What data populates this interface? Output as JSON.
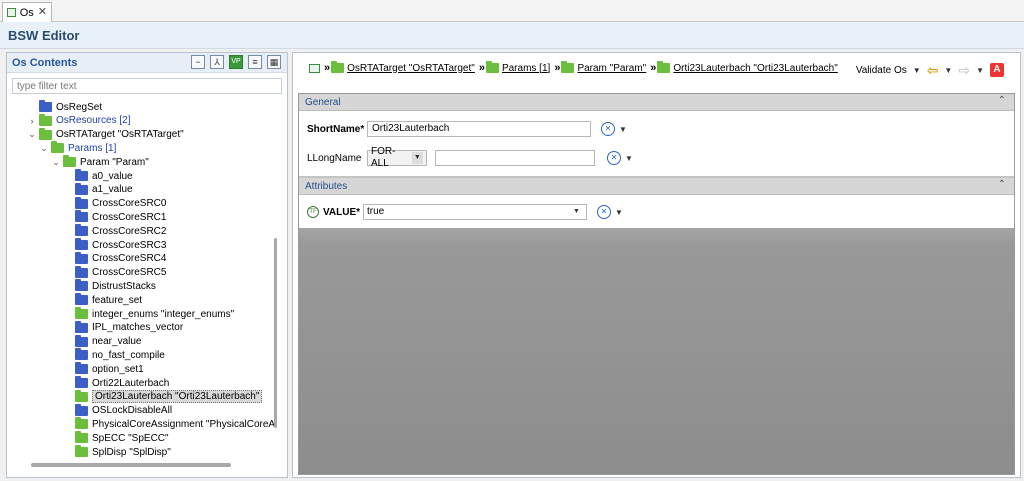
{
  "tab": {
    "label": "Os",
    "close": "✕"
  },
  "editor": {
    "title": "BSW Editor"
  },
  "left_panel": {
    "title": "Os Contents",
    "filter_placeholder": "type filter text",
    "tree": [
      {
        "label": "OsRegSet",
        "color": "blue",
        "twisty": ""
      },
      {
        "label": "OsResources [2]",
        "color": "green",
        "twisty": "›",
        "link": true
      },
      {
        "label": "OsRTATarget \"OsRTATarget\"",
        "color": "green",
        "twisty": "⌄"
      },
      {
        "label": "Params [1]",
        "color": "green",
        "twisty": "⌄",
        "link": true
      },
      {
        "label": "Param \"Param\"",
        "color": "green",
        "twisty": "⌄"
      },
      {
        "label": "a0_value",
        "color": "blue"
      },
      {
        "label": "a1_value",
        "color": "blue"
      },
      {
        "label": "CrossCoreSRC0",
        "color": "blue"
      },
      {
        "label": "CrossCoreSRC1",
        "color": "blue"
      },
      {
        "label": "CrossCoreSRC2",
        "color": "blue"
      },
      {
        "label": "CrossCoreSRC3",
        "color": "blue"
      },
      {
        "label": "CrossCoreSRC4",
        "color": "blue"
      },
      {
        "label": "CrossCoreSRC5",
        "color": "blue"
      },
      {
        "label": "DistrustStacks",
        "color": "blue"
      },
      {
        "label": "feature_set",
        "color": "blue"
      },
      {
        "label": "integer_enums \"integer_enums\"",
        "color": "green"
      },
      {
        "label": "IPL_matches_vector",
        "color": "blue"
      },
      {
        "label": "near_value",
        "color": "blue"
      },
      {
        "label": "no_fast_compile",
        "color": "blue"
      },
      {
        "label": "option_set1",
        "color": "blue"
      },
      {
        "label": "Orti22Lauterbach",
        "color": "blue"
      },
      {
        "label": "Orti23Lauterbach \"Orti23Lauterbach\"",
        "color": "green",
        "selected": true
      },
      {
        "label": "OSLockDisableAll",
        "color": "blue"
      },
      {
        "label": "PhysicalCoreAssignment \"PhysicalCoreAss",
        "color": "green"
      },
      {
        "label": "SpECC \"SpECC\"",
        "color": "green"
      },
      {
        "label": "SplDisp \"SplDisp\"",
        "color": "green"
      }
    ]
  },
  "breadcrumb": {
    "items": [
      "OsRTATarget \"OsRTATarget\"",
      "Params [1]",
      "Param \"Param\"",
      "Orti23Lauterbach \"Orti23Lauterbach\""
    ]
  },
  "toolbar": {
    "validate_label": "Validate Os",
    "a_icon": "A"
  },
  "general": {
    "title": "General",
    "shortname_label": "ShortName*",
    "shortname_value": "Orti23Lauterbach",
    "llongname_label": "LLongName",
    "llongname_lang": "FOR-ALL",
    "llongname_value": ""
  },
  "attributes": {
    "title": "Attributes",
    "value_label": "VALUE*",
    "value_value": "true"
  },
  "colors": {
    "folder_blue": "#3b5fc4",
    "folder_green": "#6cbf3c",
    "header_text": "#2a4c6e",
    "link": "#1f3fa8"
  }
}
